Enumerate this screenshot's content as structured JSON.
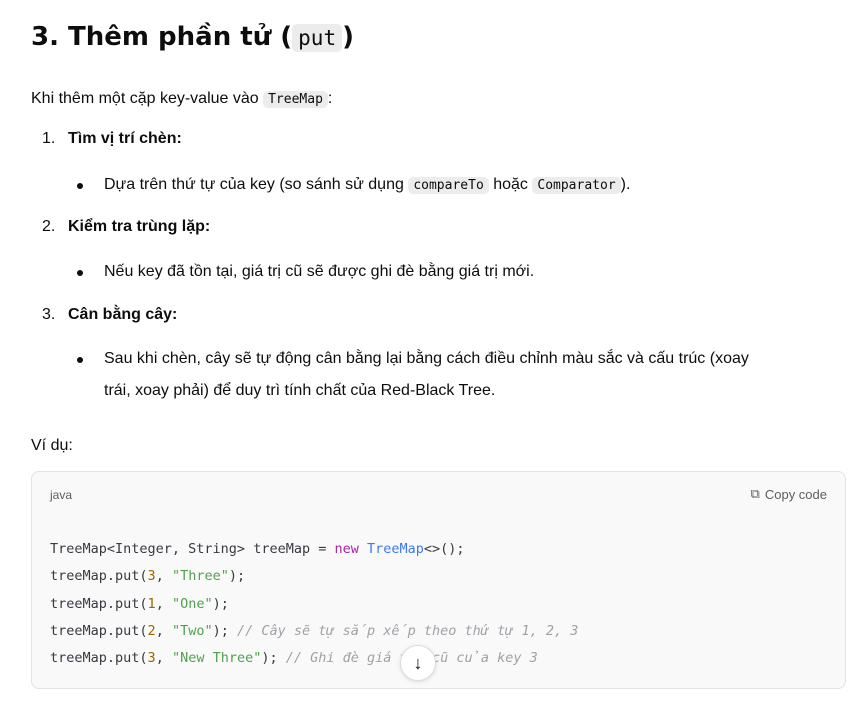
{
  "heading": {
    "prefix": "3. Thêm phần tử (",
    "code": "put",
    "suffix": ")"
  },
  "intro": {
    "text": "Khi thêm một cặp key-value vào ",
    "code": "TreeMap",
    "suffix": ":"
  },
  "steps": [
    {
      "num": "1.",
      "title": "Tìm vị trí chèn:",
      "bullet_pre": "Dựa trên thứ tự của key (so sánh sử dụng ",
      "code1": "compareTo",
      "mid": " hoặc ",
      "code2": "Comparator",
      "post": ")."
    },
    {
      "num": "2.",
      "title": "Kiểm tra trùng lặp:",
      "bullet": "Nếu key đã tồn tại, giá trị cũ sẽ được ghi đè bằng giá trị mới."
    },
    {
      "num": "3.",
      "title": "Cân bằng cây:",
      "bullet_line1": "Sau khi chèn, cây sẽ tự động cân bằng lại bằng cách điều chỉnh màu sắc và cấu trúc (xoay",
      "bullet_line2": "trái, xoay phải) để duy trì tính chất của Red-Black Tree."
    }
  ],
  "example_label": "Ví dụ:",
  "code_block": {
    "language": "java",
    "copy_label": "Copy code",
    "lines": [
      "TreeMap<Integer, String> treeMap = new TreeMap<>();",
      "treeMap.put(3, \"Three\");",
      "treeMap.put(1, \"One\");",
      "treeMap.put(2, \"Two\"); // Cây sẽ tự sắp xếp theo thứ tự 1, 2, 3",
      "treeMap.put(3, \"New Three\"); // Ghi đè giá trị cũ của key 3"
    ]
  },
  "scroll_icon": "arrow-down-icon"
}
